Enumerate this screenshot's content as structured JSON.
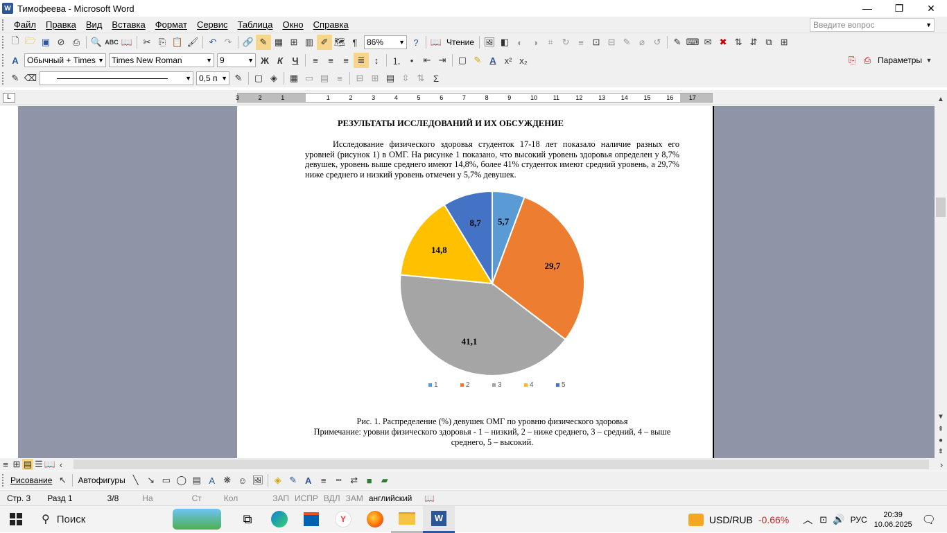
{
  "window": {
    "title": "Тимофеева - Microsoft Word",
    "app_icon": "W"
  },
  "menu": {
    "items": [
      "Файл",
      "Правка",
      "Вид",
      "Вставка",
      "Формат",
      "Сервис",
      "Таблица",
      "Окно",
      "Справка"
    ],
    "question_placeholder": "Введите вопрос"
  },
  "toolbar1": {
    "zoom": "86%",
    "reading_label": "Чтение"
  },
  "toolbar2": {
    "style": "Обычный + Times",
    "font": "Times New Roman",
    "size": "9",
    "params_label": "Параметры"
  },
  "toolbar3": {
    "line_weight": "0,5 п"
  },
  "ruler": {
    "labels": [
      "3",
      "2",
      "1",
      "1",
      "2",
      "3",
      "4",
      "5",
      "6",
      "7",
      "8",
      "9",
      "10",
      "11",
      "12",
      "13",
      "14",
      "15",
      "16",
      "17"
    ]
  },
  "document": {
    "heading": "РЕЗУЛЬТАТЫ ИССЛЕДОВАНИЙ И ИХ ОБСУЖДЕНИЕ",
    "paragraph": "Исследование физического здоровья студенток 17-18 лет показало наличие разных его уровней (рисунок 1) в ОМГ. На рисунке 1 показано, что высокий уровень здоровья определен у 8,7% девушек, уровень выше среднего имеют 14,8%, более 41% студенток имеют средний уровень, а 29,7% ниже среднего и низкий уровень отмечен у 5,7% девушек.",
    "caption_line1": "Рис. 1. Распределение (%) девушек ОМГ по уровню физического здоровья",
    "caption_line2": "Примечание: уровни физического здоровья - 1 – низкий, 2 – ниже среднего, 3 – средний, 4 – выше среднего, 5 – высокий."
  },
  "chart_data": {
    "type": "pie",
    "categories": [
      "1",
      "2",
      "3",
      "4",
      "5"
    ],
    "values": [
      5.7,
      29.7,
      41.1,
      14.8,
      8.7
    ],
    "labels": [
      "5,7",
      "29,7",
      "41,1",
      "14,8",
      "8,7"
    ],
    "colors": [
      "#5b9bd5",
      "#ed7d31",
      "#a5a5a5",
      "#ffc000",
      "#4472c4"
    ],
    "legend_position": "bottom",
    "start": "12 o'clock, clockwise"
  },
  "drawing": {
    "draw_label": "Рисование",
    "autoshapes_label": "Автофигуры"
  },
  "status": {
    "page": "Стр. 3",
    "section": "Разд 1",
    "pages": "3/8",
    "at": "На",
    "line": "Ст",
    "col": "Кол",
    "rec": "ЗАП",
    "trk": "ИСПР",
    "ext": "ВДЛ",
    "ovr": "ЗАМ",
    "lang": "английский"
  },
  "taskbar": {
    "search": "Поиск",
    "currency": "USD/RUB",
    "currency_change": "-0.66%",
    "lang": "РУС",
    "time": "20:39",
    "date": "10.06.2025"
  }
}
